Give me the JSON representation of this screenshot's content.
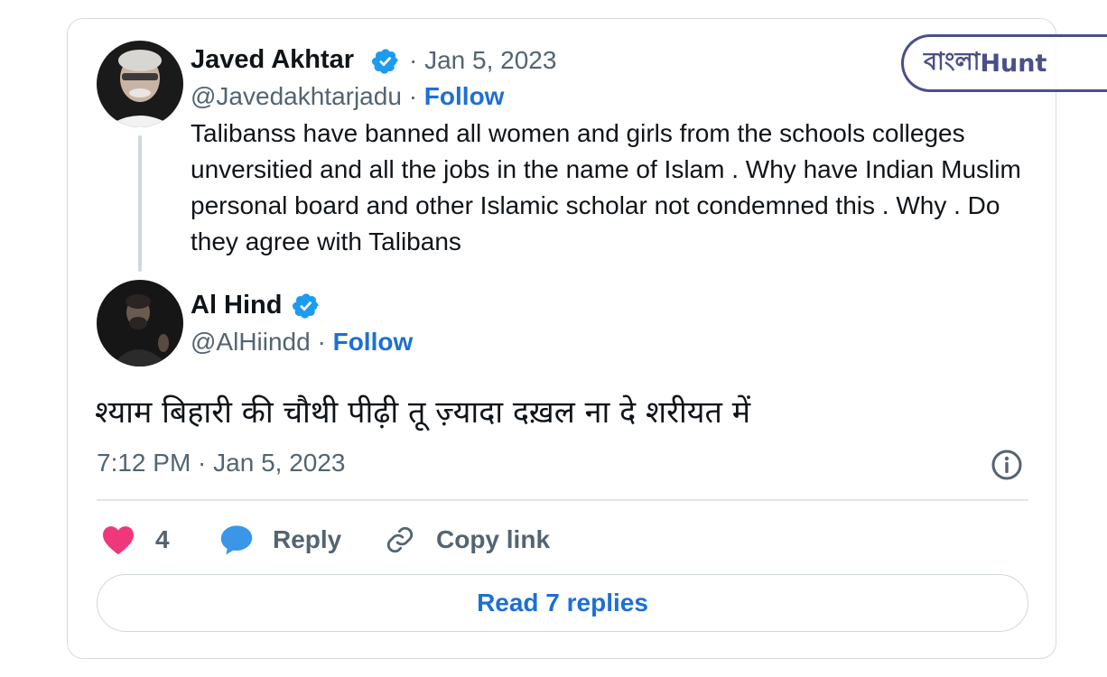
{
  "colors": {
    "link_blue": "#1d6fd6",
    "verified_blue": "#1d9bf0",
    "secondary_text": "#536471",
    "like_pink": "#f0377b",
    "reply_blue": "#3b96e8"
  },
  "quoted_tweet": {
    "author_name": "Javed Akhtar",
    "date": "Jan 5, 2023",
    "handle": "@Javedakhtarjadu",
    "follow_label": "Follow",
    "separator": "·",
    "text": "Talibanss have banned all women and girls from the schools colleges unversitied and all the jobs in the name of Islam . Why have Indian Muslim personal board and other Islamic scholar not condemned this . Why . Do they agree with Talibans"
  },
  "reply_tweet": {
    "author_name": "Al Hind",
    "handle": "@AlHiindd",
    "follow_label": "Follow",
    "separator": "·",
    "text": "श्याम बिहारी की चौथी पीढ़ी तू ज़्यादा दख़ल ना दे शरीयत में",
    "timestamp": "7:12 PM · Jan 5, 2023"
  },
  "actions": {
    "like_count": "4",
    "reply_label": "Reply",
    "copy_link_label": "Copy link"
  },
  "read_replies_label": "Read 7 replies",
  "watermark": {
    "part1": "বাংলা",
    "part2": "Hunt"
  },
  "icons": {
    "verified": "verified-badge-icon",
    "info": "info-icon",
    "like": "heart-icon",
    "reply": "speech-bubble-icon",
    "copy_link": "link-icon"
  }
}
